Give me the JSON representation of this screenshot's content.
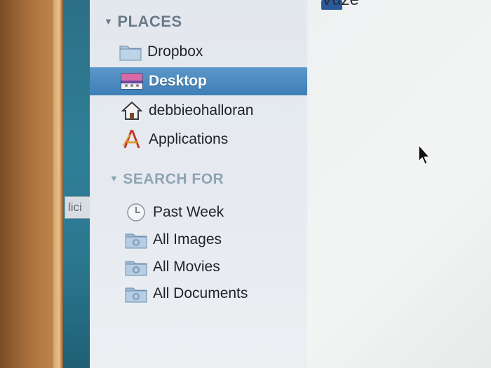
{
  "content": {
    "top_item": "Vuze"
  },
  "sidebar": {
    "places_header": "PLACES",
    "places": [
      {
        "label": "Dropbox",
        "icon": "folder-icon"
      },
      {
        "label": "Desktop",
        "icon": "desktop-icon",
        "selected": true
      },
      {
        "label": "debbieohalloran",
        "icon": "home-icon"
      },
      {
        "label": "Applications",
        "icon": "applications-icon"
      }
    ],
    "search_header": "SEARCH FOR",
    "search": [
      {
        "label": "Past Week",
        "icon": "clock-icon"
      },
      {
        "label": "All Images",
        "icon": "smart-folder-icon"
      },
      {
        "label": "All Movies",
        "icon": "smart-folder-icon"
      },
      {
        "label": "All Documents",
        "icon": "smart-folder-icon"
      }
    ]
  },
  "background_window_fragment": "lici",
  "colors": {
    "selection": "#3e7fb8",
    "header_text": "#6b7a88",
    "sidebar_bg": "#e3e8ee"
  }
}
